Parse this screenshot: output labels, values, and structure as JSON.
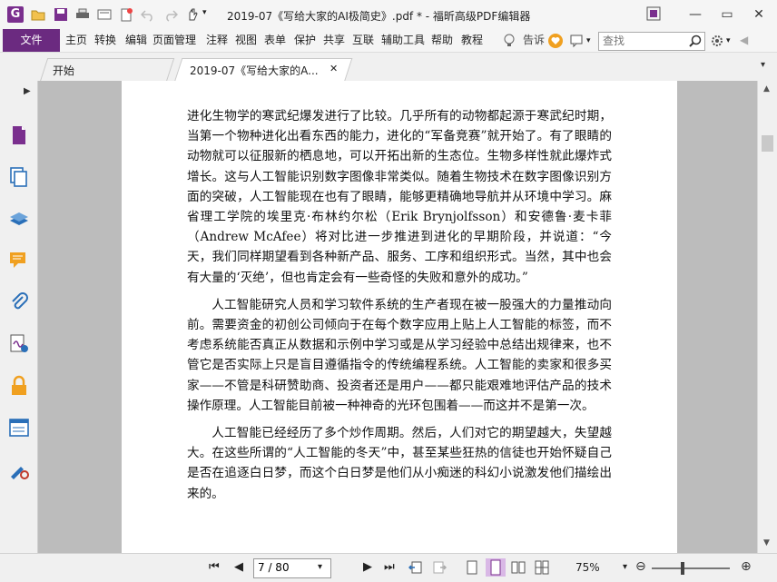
{
  "window": {
    "title": "2019-07《写给大家的AI极简史》.pdf * - 福昕高级PDF编辑器",
    "app_logo": "G"
  },
  "menubar": {
    "file": "文件",
    "items": [
      "主页",
      "转换",
      "编辑",
      "页面管理",
      "注释",
      "视图",
      "表单",
      "保护",
      "共享",
      "互联",
      "辅助工具",
      "帮助",
      "教程"
    ],
    "tell_me": "告诉",
    "search_placeholder": "查找"
  },
  "tabs": [
    {
      "label": "开始"
    },
    {
      "label": "2019-07《写给大家的A...",
      "close": "✕"
    }
  ],
  "document": {
    "paragraphs": [
      "进化生物学的寒武纪爆发进行了比较。几乎所有的动物都起源于寒武纪时期，当第一个物种进化出看东西的能力，进化的“军备竞赛”就开始了。有了眼睛的动物就可以征服新的栖息地，可以开拓出新的生态位。生物多样性就此爆炸式增长。这与人工智能识别数字图像非常类似。随着生物技术在数字图像识别方面的突破，人工智能现在也有了眼睛，能够更精确地导航并从环境中学习。麻省理工学院的埃里克·布林约尔松（Erik Brynjolfsson）和安德鲁·麦卡菲（Andrew McAfee）将对比进一步推进到进化的早期阶段，并说道：“今天，我们同样期望看到各种新产品、服务、工序和组织形式。当然，其中也会有大量的‘灭绝’，但也肯定会有一些奇怪的失败和意外的成功。”",
      "人工智能研究人员和学习软件系统的生产者现在被一股强大的力量推动向前。需要资金的初创公司倾向于在每个数字应用上贴上人工智能的标签，而不考虑系统能否真正从数据和示例中学习或是从学习经验中总结出规律来，也不管它是否实际上只是盲目遵循指令的传统编程系统。人工智能的卖家和很多买家——不管是科研赞助商、投资者还是用户——都只能艰难地评估产品的技术操作原理。人工智能目前被一种神奇的光环包围着——而这并不是第一次。",
      "人工智能已经经历了多个炒作周期。然后，人们对它的期望越大，失望越大。在这些所谓的“人工智能的冬天”中，甚至某些狂热的信徒也开始怀疑自己是否在追逐白日梦，而这个白日梦是他们从小痴迷的科幻小说激发他们描绘出来的。"
    ]
  },
  "statusbar": {
    "page_value": "7 / 80",
    "zoom": "75%"
  },
  "colors": {
    "accent": "#6b2a80",
    "doc_background": "#bcbcbc"
  }
}
